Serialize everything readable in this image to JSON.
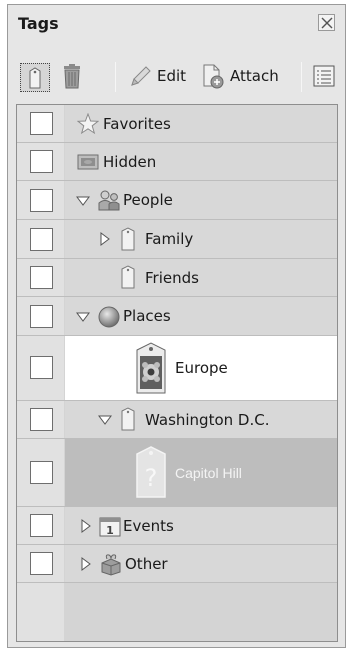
{
  "panel": {
    "title": "Tags"
  },
  "toolbar": {
    "edit_label": "Edit",
    "attach_label": "Attach"
  },
  "tags": [
    {
      "label": "Favorites",
      "icon": "star-icon"
    },
    {
      "label": "Hidden",
      "icon": "hidden-icon"
    },
    {
      "label": "People",
      "icon": "people-icon",
      "expanded": true
    },
    {
      "label": "Family",
      "icon": "tag-icon",
      "expanded": false
    },
    {
      "label": "Friends",
      "icon": "tag-icon"
    },
    {
      "label": "Places",
      "icon": "globe-icon",
      "expanded": true
    },
    {
      "label": "Europe",
      "icon": "flower-photo-tag-icon"
    },
    {
      "label": "Washington D.C.",
      "icon": "tag-icon",
      "expanded": true
    },
    {
      "label": "Capitol Hill",
      "icon": "question-tag-icon",
      "selected": true
    },
    {
      "label": "Events",
      "icon": "calendar-icon",
      "expanded": false
    },
    {
      "label": "Other",
      "icon": "gift-icon",
      "expanded": false
    }
  ]
}
